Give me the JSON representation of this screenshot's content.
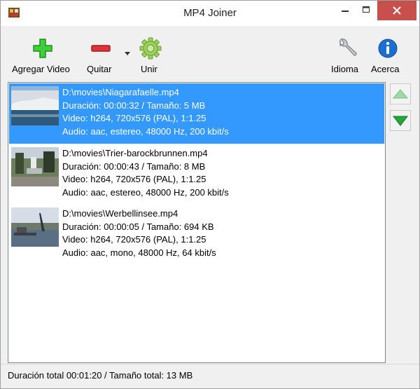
{
  "window": {
    "title": "MP4 Joiner"
  },
  "toolbar": {
    "add_label": "Agregar Video",
    "remove_label": "Quitar",
    "join_label": "Unir",
    "language_label": "Idioma",
    "about_label": "Acerca"
  },
  "files": [
    {
      "path": "D:\\movies\\Niagarafaelle.mp4",
      "info": "Duración: 00:00:32 / Tamaño: 5 MB",
      "video": "Video: h264, 720x576 (PAL), 1:1.25",
      "audio": "Audio: aac, estereo, 48000 Hz, 200 kbit/s",
      "selected": true
    },
    {
      "path": "D:\\movies\\Trier-barockbrunnen.mp4",
      "info": "Duración: 00:00:43 / Tamaño: 8 MB",
      "video": "Video: h264, 720x576 (PAL), 1:1.25",
      "audio": "Audio: aac, estereo, 48000 Hz, 200 kbit/s",
      "selected": false
    },
    {
      "path": "D:\\movies\\Werbellinsee.mp4",
      "info": "Duración: 00:00:05 / Tamaño: 694 KB",
      "video": "Video: h264, 720x576 (PAL), 1:1.25",
      "audio": "Audio: aac, mono, 48000 Hz, 64 kbit/s",
      "selected": false
    }
  ],
  "status": {
    "text": "Duración total 00:01:20 / Tamaño total: 13 MB"
  },
  "colors": {
    "selection": "#3399ff",
    "close_button": "#c7504d",
    "add_green": "#2fbf2f",
    "remove_red": "#d9262c"
  },
  "icons": {
    "app": "film-icon",
    "add": "plus-icon",
    "remove": "minus-icon",
    "join": "gear-icon",
    "language": "wrench-icon",
    "about": "info-icon",
    "up": "arrow-up-icon",
    "down": "arrow-down-icon"
  }
}
